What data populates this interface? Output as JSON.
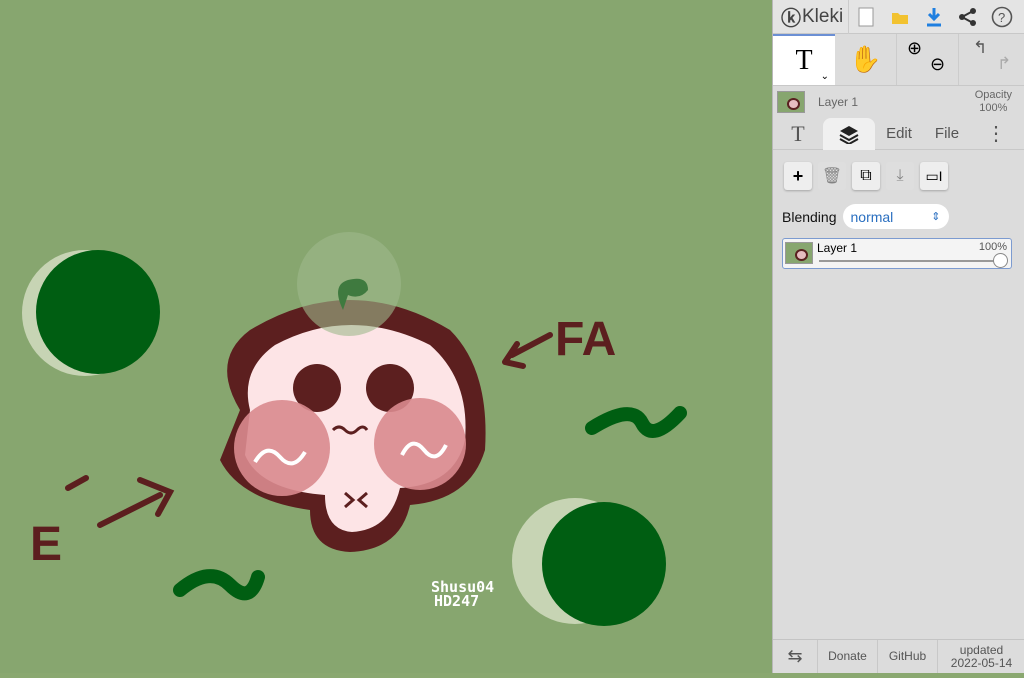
{
  "app": {
    "name": "Kleki"
  },
  "canvas": {
    "signature_line1": "Shusu04",
    "signature_line2": "HD247",
    "label_fa": "FA",
    "label_e": "E"
  },
  "toolbar": {
    "current_tool": "T"
  },
  "layer_header": {
    "name": "Layer 1",
    "opacity_label": "Opacity",
    "opacity_value": "100%"
  },
  "tabs": {
    "text_tab": "T",
    "edit": "Edit",
    "file": "File"
  },
  "layers_panel": {
    "blending_label": "Blending",
    "blending_value": "normal",
    "layers": [
      {
        "name": "Layer 1",
        "opacity": "100%",
        "opacity_fraction": 1.0
      }
    ]
  },
  "footer": {
    "donate": "Donate",
    "github": "GitHub",
    "updated_label": "updated",
    "updated_date": "2022-05-14"
  }
}
